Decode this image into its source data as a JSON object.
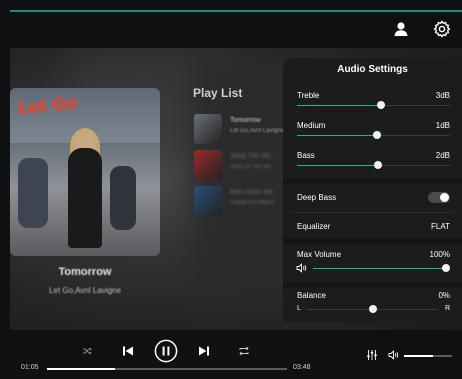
{
  "now_playing": {
    "title": "Tomorrow",
    "artist": "Let Go,Avril Lavigne",
    "cover_text": "Let Go",
    "elapsed": "01:05",
    "duration": "03:48",
    "progress": 0.285
  },
  "playlist": {
    "title": "Play List",
    "items": [
      {
        "title": "Tomorrow",
        "subtitle": "Let Go,Avril Lavigne",
        "thumb_color": "#6a6f78",
        "dim": false
      },
      {
        "title": "Steal The Wi...",
        "subtitle": "Way Of The Wi...",
        "thumb_color": "#9c2a2a",
        "dim": true
      },
      {
        "title": "Rain Over Me",
        "subtitle": "Planet Pit,Pitbull",
        "thumb_color": "#2a4f7a",
        "dim": true
      }
    ]
  },
  "audio_settings": {
    "title": "Audio Settings",
    "treble": {
      "label": "Treble",
      "value": "3dB",
      "level": 0.55
    },
    "medium": {
      "label": "Medium",
      "value": "1dB",
      "level": 0.52
    },
    "bass": {
      "label": "Bass",
      "value": "2dB",
      "level": 0.53
    },
    "deep_bass": {
      "label": "Deep Bass",
      "on": false
    },
    "equalizer": {
      "label": "Equalizer",
      "value": "FLAT"
    },
    "max_volume": {
      "label": "Max Volume",
      "value": "100%",
      "level": 1.0
    },
    "balance": {
      "label": "Balance",
      "value": "0%",
      "left": "L",
      "right": "R",
      "level": 0.5
    }
  },
  "volume": {
    "level": 0.6
  },
  "icons": {
    "user": "user-icon",
    "settings": "gear-icon",
    "shuffle": "shuffle-icon",
    "previous": "previous-icon",
    "play_pause": "pause-icon",
    "next": "next-icon",
    "repeat": "repeat-icon",
    "equalizer": "equalizer-icon",
    "volume": "volume-icon"
  },
  "colors": {
    "accent": "#2bb38f",
    "panel": "#1b1c1d",
    "top_accent": "#1f8a8a"
  }
}
